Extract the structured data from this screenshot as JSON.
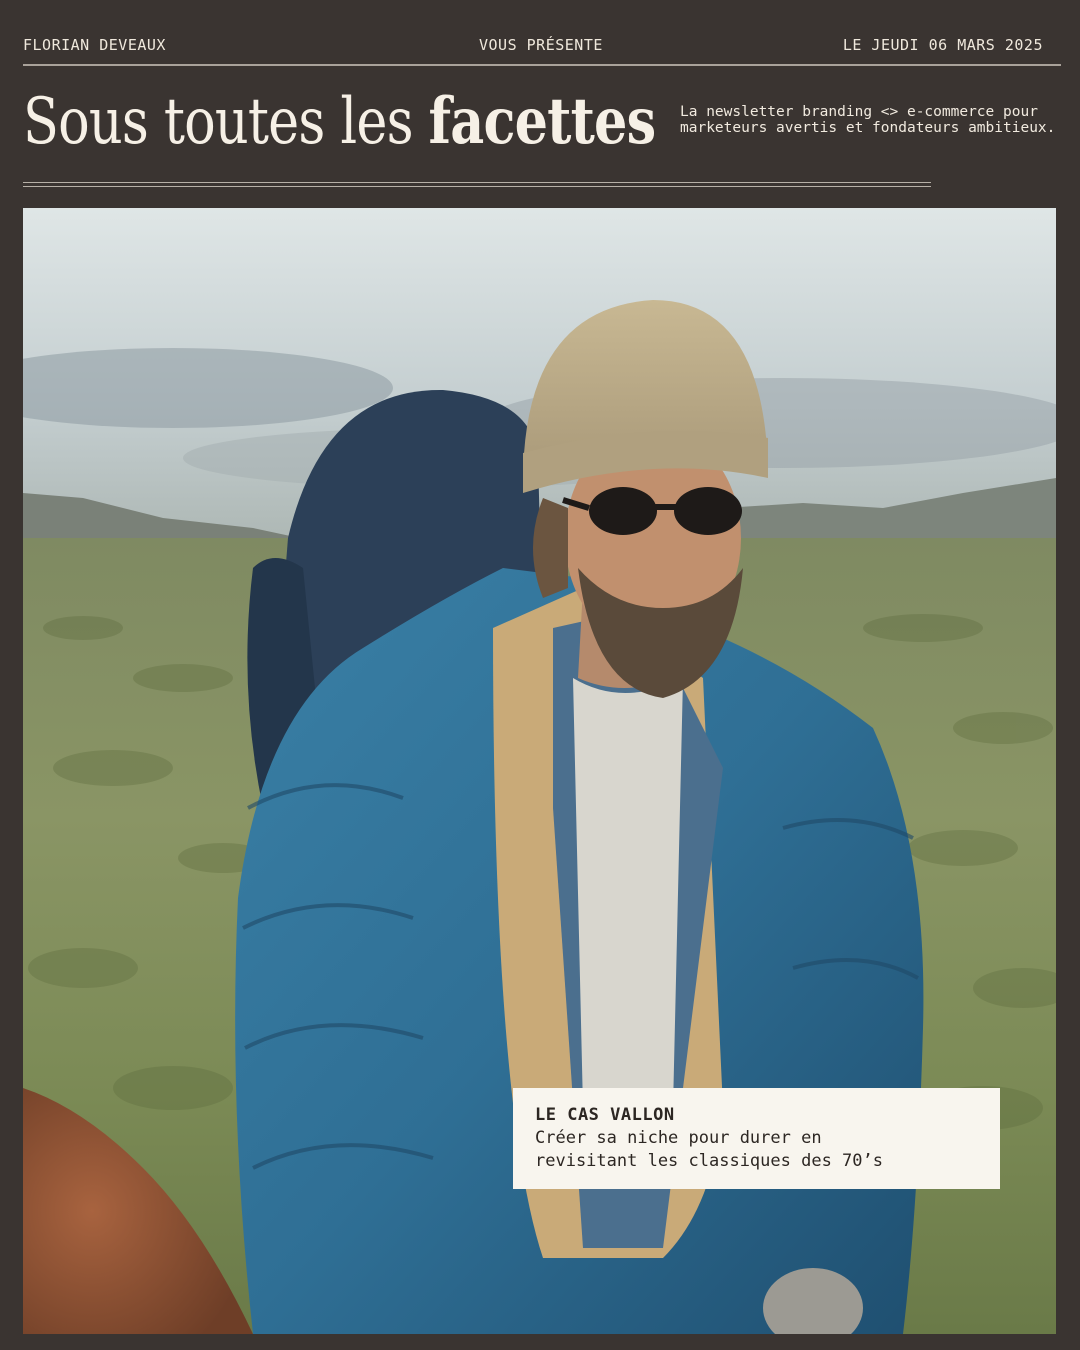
{
  "header": {
    "author": "FLORIAN DEVEAUX",
    "presents": "VOUS PRÉSENTE",
    "date": "LE JEUDI 06 MARS 2025"
  },
  "masthead": {
    "title_light": "Sous toutes les ",
    "title_bold": "facettes",
    "tagline": "La newsletter branding <> e-commerce pour marketeurs avertis et fondateurs ambitieux."
  },
  "caption": {
    "kicker": "LE CAS VALLON",
    "line1": "Créer sa niche pour durer en",
    "line2": "revisitant les classiques des 70’s"
  },
  "colors": {
    "background": "#3a3431",
    "text_light": "#f3ede3",
    "caption_bg": "#f8f5ee",
    "jacket_blue": "#2f6f95"
  }
}
